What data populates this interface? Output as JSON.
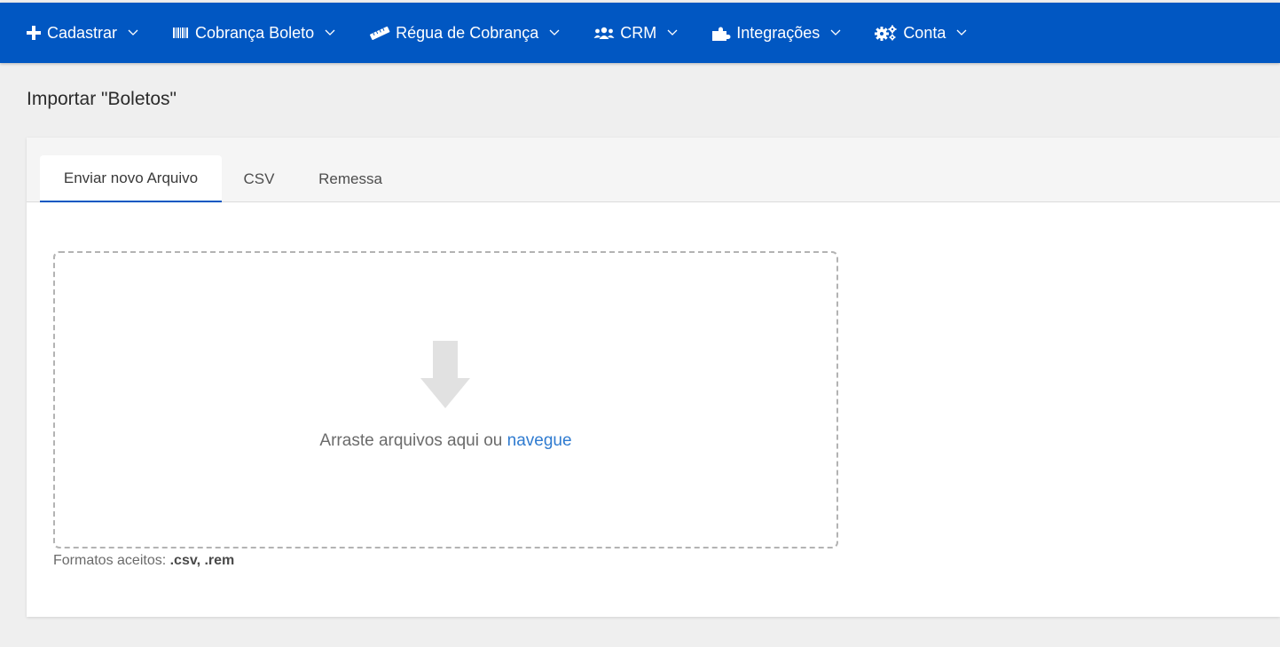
{
  "navbar": {
    "items": [
      {
        "label": "Cadastrar",
        "icon": "plus-icon"
      },
      {
        "label": "Cobrança Boleto",
        "icon": "barcode-icon"
      },
      {
        "label": "Régua de Cobrança",
        "icon": "ruler-icon"
      },
      {
        "label": "CRM",
        "icon": "users-icon"
      },
      {
        "label": "Integrações",
        "icon": "puzzle-icon"
      },
      {
        "label": "Conta",
        "icon": "gears-icon"
      }
    ]
  },
  "page": {
    "title": "Importar \"Boletos\""
  },
  "tabs": [
    {
      "label": "Enviar novo Arquivo",
      "active": true
    },
    {
      "label": "CSV",
      "active": false
    },
    {
      "label": "Remessa",
      "active": false
    }
  ],
  "dropzone": {
    "text": "Arraste arquivos aqui ou",
    "link": "navegue",
    "icon": "arrow-down-icon"
  },
  "formats": {
    "label": "Formatos aceitos:",
    "values": ".csv, .rem"
  },
  "colors": {
    "primary": "#0157c2",
    "link": "#2f7bd0",
    "background": "#efefef"
  }
}
